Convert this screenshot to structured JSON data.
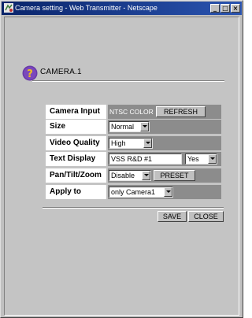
{
  "window": {
    "title": "Camera setting - Web Transmitter - Netscape",
    "minimize_glyph": "_",
    "maximize_glyph": "□",
    "close_glyph": "×"
  },
  "icons": {
    "app": "netscape-app-icon",
    "help": "help-icon"
  },
  "colors": {
    "titlebar": "#0a246a",
    "help_icon_bg": "#6a3aa8",
    "help_icon_fg": "#f0c020",
    "value_cell": "#8c8c8c"
  },
  "camera": {
    "title": "CAMERA.1"
  },
  "form": {
    "camera_input": {
      "label": "Camera Input",
      "value": "NTSC COLOR",
      "button": "REFRESH"
    },
    "size": {
      "label": "Size",
      "selected": "Normal"
    },
    "video_quality": {
      "label": "Video Quality",
      "selected": "High"
    },
    "text_display": {
      "label": "Text Display",
      "text_value": "VSS R&D #1",
      "selected": "Yes"
    },
    "pan_tilt_zoom": {
      "label": "Pan/Tilt/Zoom",
      "selected": "Disable",
      "button": "PRESET"
    },
    "apply_to": {
      "label": "Apply to",
      "selected": "only Camera1"
    }
  },
  "actions": {
    "save": "SAVE",
    "close": "CLOSE"
  }
}
